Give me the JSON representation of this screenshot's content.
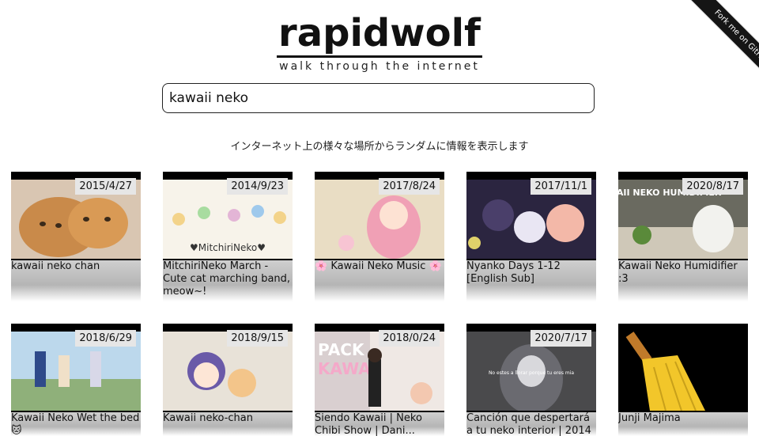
{
  "header": {
    "title": "rapidwolf",
    "subtitle": "walk through the internet"
  },
  "search": {
    "value": "kawaii neko"
  },
  "tagline": "インターネット上の様々な場所からランダムに情報を表示します",
  "ribbon": {
    "label": "Fork me on GitHub"
  },
  "cards": [
    {
      "date": "2015/4/27",
      "title": "kawaii neko chan"
    },
    {
      "date": "2014/9/23",
      "title": "MitchiriNeko March - Cute cat marching band, meow~!"
    },
    {
      "date": "2017/8/24",
      "title": "🌸 Kawaii Neko Music 🌸"
    },
    {
      "date": "2017/11/1",
      "title": "Nyanko Days 1-12 [English Sub]"
    },
    {
      "date": "2020/8/17",
      "title": "Kawaii Neko Humidifier :3"
    },
    {
      "date": "2018/6/29",
      "title": "Kawaii Neko Wet the bed 🐱"
    },
    {
      "date": "2018/9/15",
      "title": "Kawaii neko-chan"
    },
    {
      "date": "2018/0/24",
      "title": "Siendo Kawaii | Neko Chibi Show | Dani..."
    },
    {
      "date": "2020/7/17",
      "title": "Canción que despertará a tu neko interior | 2014"
    },
    {
      "date": "",
      "title": "Junji Majima"
    }
  ],
  "thumb_text": {
    "card2": "♥MitchiriNeko♥",
    "card5": "KAWAII NEKO HUMIDIFIER",
    "card8a": "PACK",
    "card8b": "KAWAII",
    "card9": "No estes a llorar porque tu eres mia"
  },
  "colors": {
    "ribbon_bg": "#151515",
    "date_badge_bg": "#e6e6e6",
    "caption_gray": "#c4c4c4"
  }
}
